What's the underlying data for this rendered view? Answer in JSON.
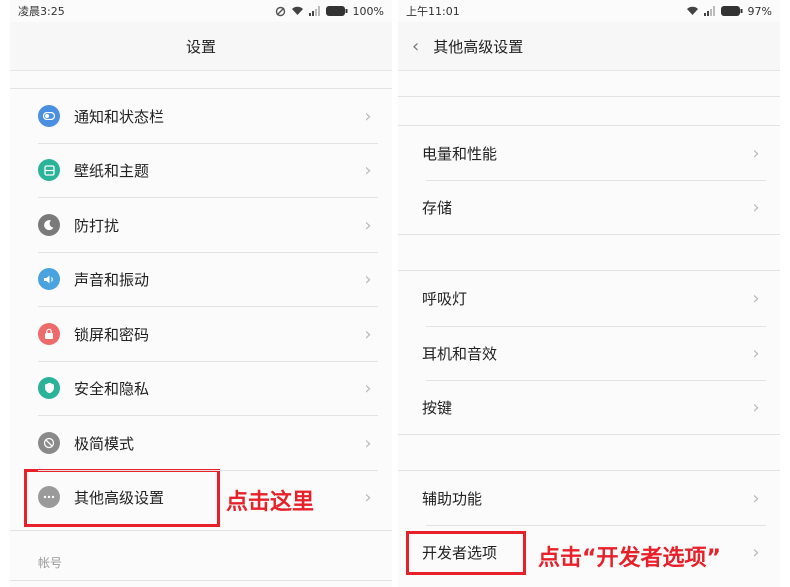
{
  "left_screen": {
    "status": {
      "time": "凌晨3:25",
      "battery": "100%"
    },
    "title": "设置",
    "items": [
      {
        "label": "通知和状态栏",
        "icon": "toggle-icon",
        "color": "#4a90e2"
      },
      {
        "label": "壁纸和主题",
        "icon": "theme-icon",
        "color": "#2bb39a"
      },
      {
        "label": "防打扰",
        "icon": "moon-icon",
        "color": "#7a7a7a"
      },
      {
        "label": "声音和振动",
        "icon": "speaker-icon",
        "color": "#4aa3df"
      },
      {
        "label": "锁屏和密码",
        "icon": "lock-icon",
        "color": "#ef6b6b"
      },
      {
        "label": "安全和隐私",
        "icon": "shield-icon",
        "color": "#2bb39a"
      },
      {
        "label": "极简模式",
        "icon": "circle-slash-icon",
        "color": "#8a8a8a"
      },
      {
        "label": "其他高级设置",
        "icon": "more-icon",
        "color": "#9a9a9a"
      }
    ],
    "section_label": "帐号",
    "annotation": "点击这里"
  },
  "right_screen": {
    "status": {
      "time": "上午11:01",
      "battery": "97%"
    },
    "title": "其他高级设置",
    "items": [
      {
        "label": "电量和性能"
      },
      {
        "label": "存储"
      },
      {
        "label": "呼吸灯"
      },
      {
        "label": "耳机和音效"
      },
      {
        "label": "按键"
      },
      {
        "label": "辅助功能"
      },
      {
        "label": "开发者选项"
      }
    ],
    "annotation": "点击“开发者选项”"
  },
  "colors": {
    "highlight": "#e8202a"
  }
}
